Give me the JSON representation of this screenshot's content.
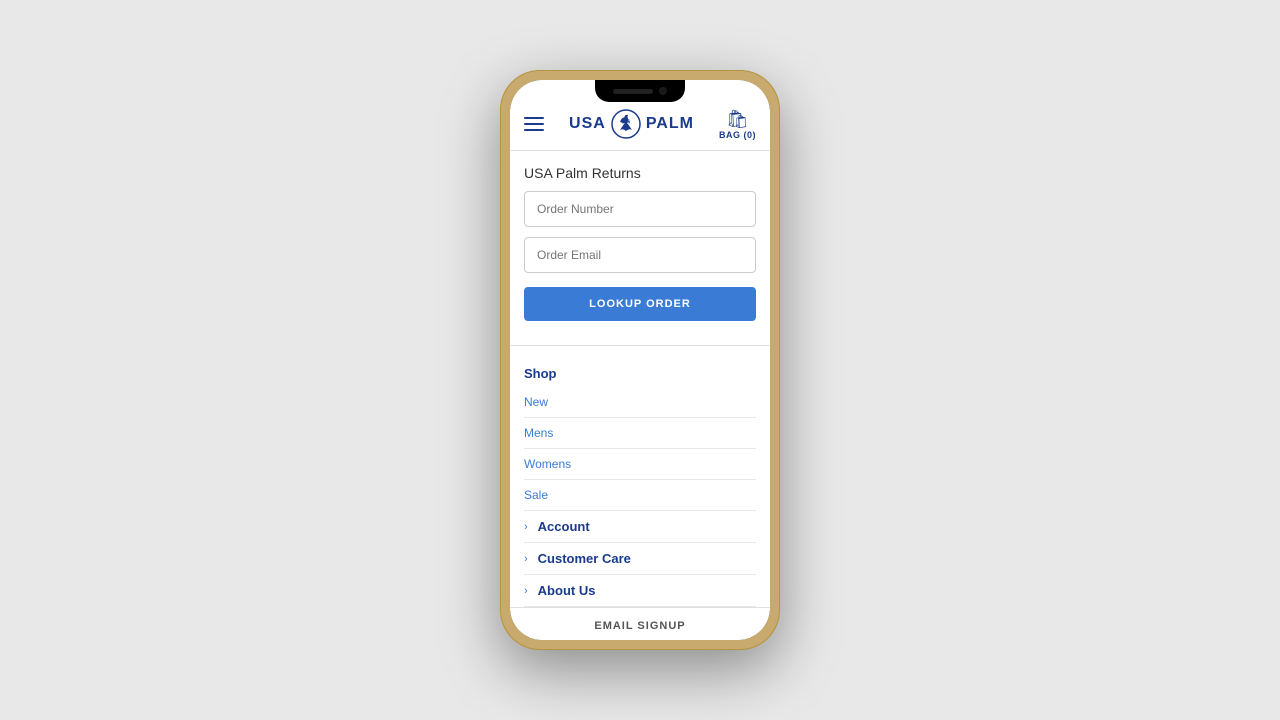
{
  "phone": {
    "notch": true
  },
  "header": {
    "logo_text_left": "USA",
    "logo_text_right": "PALM",
    "bag_label": "BAG (0)"
  },
  "page": {
    "title": "USA Palm Returns"
  },
  "form": {
    "order_number_placeholder": "Order Number",
    "order_email_placeholder": "Order Email",
    "lookup_button_label": "LOOKUP ORDER"
  },
  "nav": {
    "shop_label": "Shop",
    "shop_items": [
      {
        "label": "New"
      },
      {
        "label": "Mens"
      },
      {
        "label": "Womens"
      },
      {
        "label": "Sale"
      }
    ],
    "expandable_items": [
      {
        "label": "Account"
      },
      {
        "label": "Customer Care"
      },
      {
        "label": "About Us"
      }
    ],
    "email_signup_label": "EMAIL SIGNUP"
  },
  "colors": {
    "brand_blue": "#1a3a8c",
    "link_blue": "#3a7bd5",
    "button_blue": "#3a7bd5"
  }
}
